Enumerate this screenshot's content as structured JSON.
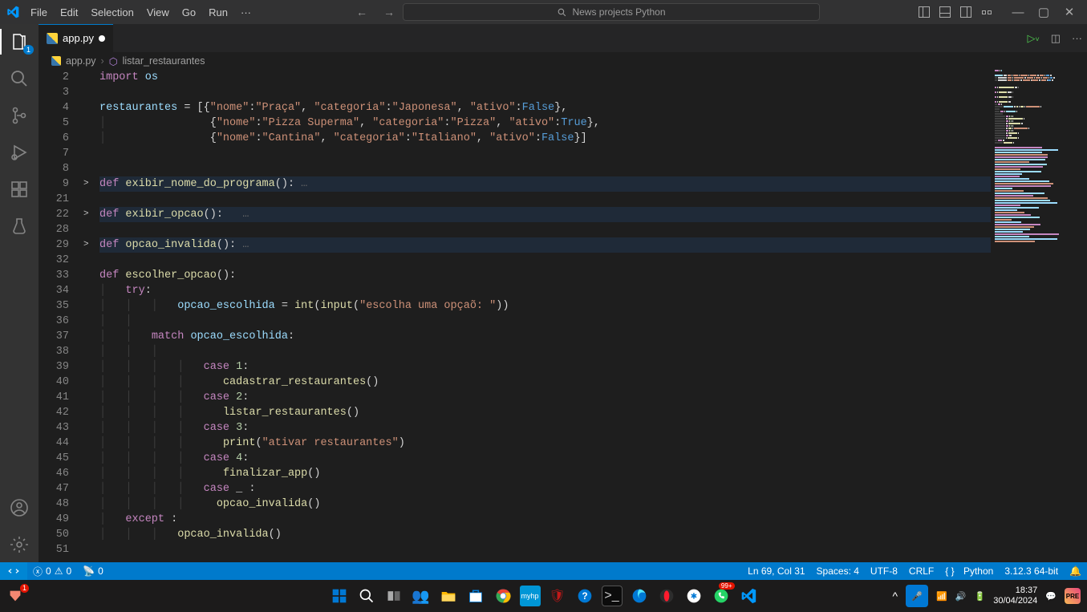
{
  "menu": [
    "File",
    "Edit",
    "Selection",
    "View",
    "Go",
    "Run",
    "···"
  ],
  "command_center": "News projects Python",
  "activity_badge": "1",
  "tab": {
    "name": "app.py"
  },
  "breadcrumb": {
    "file": "app.py",
    "symbol": "listar_restaurantes"
  },
  "tabs_actions": {
    "run": "▷",
    "split": "▯",
    "more": "···"
  },
  "code": {
    "lines": [
      {
        "n": "2",
        "fold": "",
        "t": [
          [
            "kw",
            "import"
          ],
          [
            "pun",
            " "
          ],
          [
            "var",
            "os"
          ]
        ]
      },
      {
        "n": "3",
        "fold": "",
        "t": []
      },
      {
        "n": "4",
        "fold": "",
        "t": [
          [
            "var",
            "restaurantes"
          ],
          [
            "pun",
            " = [{"
          ],
          [
            "str",
            "\"nome\""
          ],
          [
            "pun",
            ":"
          ],
          [
            "str",
            "\"Praça\""
          ],
          [
            "pun",
            ", "
          ],
          [
            "str",
            "\"categoria\""
          ],
          [
            "pun",
            ":"
          ],
          [
            "str",
            "\"Japonesa\""
          ],
          [
            "pun",
            ", "
          ],
          [
            "str",
            "\"ativo\""
          ],
          [
            "pun",
            ":"
          ],
          [
            "const",
            "False"
          ],
          [
            "pun",
            "},"
          ]
        ]
      },
      {
        "n": "5",
        "fold": "",
        "t": [
          [
            "guide",
            "│   "
          ],
          [
            "pun",
            "             {"
          ],
          [
            "str",
            "\"nome\""
          ],
          [
            "pun",
            ":"
          ],
          [
            "str",
            "\"Pizza Superma\""
          ],
          [
            "pun",
            ", "
          ],
          [
            "str",
            "\"categoria\""
          ],
          [
            "pun",
            ":"
          ],
          [
            "str",
            "\"Pizza\""
          ],
          [
            "pun",
            ", "
          ],
          [
            "str",
            "\"ativo\""
          ],
          [
            "pun",
            ":"
          ],
          [
            "const",
            "True"
          ],
          [
            "pun",
            "},"
          ]
        ]
      },
      {
        "n": "6",
        "fold": "",
        "t": [
          [
            "guide",
            "│   "
          ],
          [
            "pun",
            "             {"
          ],
          [
            "str",
            "\"nome\""
          ],
          [
            "pun",
            ":"
          ],
          [
            "str",
            "\"Cantina\""
          ],
          [
            "pun",
            ", "
          ],
          [
            "str",
            "\"categoria\""
          ],
          [
            "pun",
            ":"
          ],
          [
            "str",
            "\"Italiano\""
          ],
          [
            "pun",
            ", "
          ],
          [
            "str",
            "\"ativo\""
          ],
          [
            "pun",
            ":"
          ],
          [
            "const",
            "False"
          ],
          [
            "pun",
            "}]"
          ]
        ]
      },
      {
        "n": "7",
        "fold": "",
        "t": []
      },
      {
        "n": "8",
        "fold": "",
        "t": []
      },
      {
        "n": "9",
        "fold": ">",
        "hl": true,
        "t": [
          [
            "kw",
            "def"
          ],
          [
            "pun",
            " "
          ],
          [
            "fn",
            "exibir_nome_do_programa"
          ],
          [
            "pun",
            "(): "
          ],
          [
            "ellips",
            "…"
          ]
        ]
      },
      {
        "n": "21",
        "fold": "",
        "t": []
      },
      {
        "n": "22",
        "fold": ">",
        "hl": true,
        "t": [
          [
            "kw",
            "def"
          ],
          [
            "pun",
            " "
          ],
          [
            "fn",
            "exibir_opcao"
          ],
          [
            "pun",
            "():   "
          ],
          [
            "ellips",
            "…"
          ]
        ]
      },
      {
        "n": "28",
        "fold": "",
        "t": []
      },
      {
        "n": "29",
        "fold": ">",
        "hl": true,
        "t": [
          [
            "kw",
            "def"
          ],
          [
            "pun",
            " "
          ],
          [
            "fn",
            "opcao_invalida"
          ],
          [
            "pun",
            "(): "
          ],
          [
            "ellips",
            "…"
          ]
        ]
      },
      {
        "n": "32",
        "fold": "",
        "t": []
      },
      {
        "n": "33",
        "fold": "",
        "t": [
          [
            "kw",
            "def"
          ],
          [
            "pun",
            " "
          ],
          [
            "fn",
            "escolher_opcao"
          ],
          [
            "pun",
            "():"
          ]
        ]
      },
      {
        "n": "34",
        "fold": "",
        "t": [
          [
            "guide",
            "│   "
          ],
          [
            "kw",
            "try"
          ],
          [
            "pun",
            ":"
          ]
        ]
      },
      {
        "n": "35",
        "fold": "",
        "t": [
          [
            "guide",
            "│   │   │   "
          ],
          [
            "var",
            "opcao_escolhida"
          ],
          [
            "pun",
            " = "
          ],
          [
            "fn",
            "int"
          ],
          [
            "pun",
            "("
          ],
          [
            "fn",
            "input"
          ],
          [
            "pun",
            "("
          ],
          [
            "str",
            "\"escolha uma opçaõ: \""
          ],
          [
            "pun",
            "))"
          ]
        ]
      },
      {
        "n": "36",
        "fold": "",
        "t": [
          [
            "guide",
            "│   │   "
          ]
        ]
      },
      {
        "n": "37",
        "fold": "",
        "t": [
          [
            "guide",
            "│   │   "
          ],
          [
            "kw",
            "match"
          ],
          [
            "pun",
            " "
          ],
          [
            "var",
            "opcao_escolhida"
          ],
          [
            "pun",
            ":"
          ]
        ]
      },
      {
        "n": "38",
        "fold": "",
        "t": [
          [
            "guide",
            "│   │   │   "
          ]
        ]
      },
      {
        "n": "39",
        "fold": "",
        "t": [
          [
            "guide",
            "│   │   │   │   "
          ],
          [
            "kw",
            "case"
          ],
          [
            "pun",
            " "
          ],
          [
            "num",
            "1"
          ],
          [
            "pun",
            ":"
          ]
        ]
      },
      {
        "n": "40",
        "fold": "",
        "t": [
          [
            "guide",
            "│   │   │   │   "
          ],
          [
            "pun",
            "   "
          ],
          [
            "fn",
            "cadastrar_restaurantes"
          ],
          [
            "pun",
            "()"
          ]
        ]
      },
      {
        "n": "41",
        "fold": "",
        "t": [
          [
            "guide",
            "│   │   │   │   "
          ],
          [
            "kw",
            "case"
          ],
          [
            "pun",
            " "
          ],
          [
            "num",
            "2"
          ],
          [
            "pun",
            ":"
          ]
        ]
      },
      {
        "n": "42",
        "fold": "",
        "t": [
          [
            "guide",
            "│   │   │   │   "
          ],
          [
            "pun",
            "   "
          ],
          [
            "fn",
            "listar_restaurantes"
          ],
          [
            "pun",
            "()"
          ]
        ]
      },
      {
        "n": "43",
        "fold": "",
        "t": [
          [
            "guide",
            "│   │   │   │   "
          ],
          [
            "kw",
            "case"
          ],
          [
            "pun",
            " "
          ],
          [
            "num",
            "3"
          ],
          [
            "pun",
            ":"
          ]
        ]
      },
      {
        "n": "44",
        "fold": "",
        "t": [
          [
            "guide",
            "│   │   │   │   "
          ],
          [
            "pun",
            "   "
          ],
          [
            "fn",
            "print"
          ],
          [
            "pun",
            "("
          ],
          [
            "str",
            "\"ativar restaurantes\""
          ],
          [
            "pun",
            ")"
          ]
        ]
      },
      {
        "n": "45",
        "fold": "",
        "t": [
          [
            "guide",
            "│   │   │   │   "
          ],
          [
            "kw",
            "case"
          ],
          [
            "pun",
            " "
          ],
          [
            "num",
            "4"
          ],
          [
            "pun",
            ":"
          ]
        ]
      },
      {
        "n": "46",
        "fold": "",
        "t": [
          [
            "guide",
            "│   │   │   │   "
          ],
          [
            "pun",
            "   "
          ],
          [
            "fn",
            "finalizar_app"
          ],
          [
            "pun",
            "()"
          ]
        ]
      },
      {
        "n": "47",
        "fold": "",
        "t": [
          [
            "guide",
            "│   │   │   │   "
          ],
          [
            "kw",
            "case"
          ],
          [
            "pun",
            " _ :"
          ]
        ]
      },
      {
        "n": "48",
        "fold": "",
        "t": [
          [
            "guide",
            "│   │   │   │   "
          ],
          [
            "pun",
            "  "
          ],
          [
            "fn",
            "opcao_invalida"
          ],
          [
            "pun",
            "()"
          ]
        ]
      },
      {
        "n": "49",
        "fold": "",
        "t": [
          [
            "guide",
            "│   "
          ],
          [
            "kw",
            "except"
          ],
          [
            "pun",
            " :"
          ]
        ]
      },
      {
        "n": "50",
        "fold": "",
        "t": [
          [
            "guide",
            "│   │   │   "
          ],
          [
            "fn",
            "opcao_invalida"
          ],
          [
            "pun",
            "()"
          ]
        ]
      },
      {
        "n": "51",
        "fold": "",
        "t": []
      }
    ]
  },
  "status": {
    "errors": "0",
    "warnings": "0",
    "ports": "0",
    "cursor": "Ln 69, Col 31",
    "spaces": "Spaces: 4",
    "encoding": "UTF-8",
    "eol": "CRLF",
    "lang": "Python",
    "version": "3.12.3 64-bit"
  },
  "taskbar": {
    "time": "18:37",
    "date": "30/04/2024",
    "notif_count": "99+",
    "corsair_badge": "1"
  }
}
